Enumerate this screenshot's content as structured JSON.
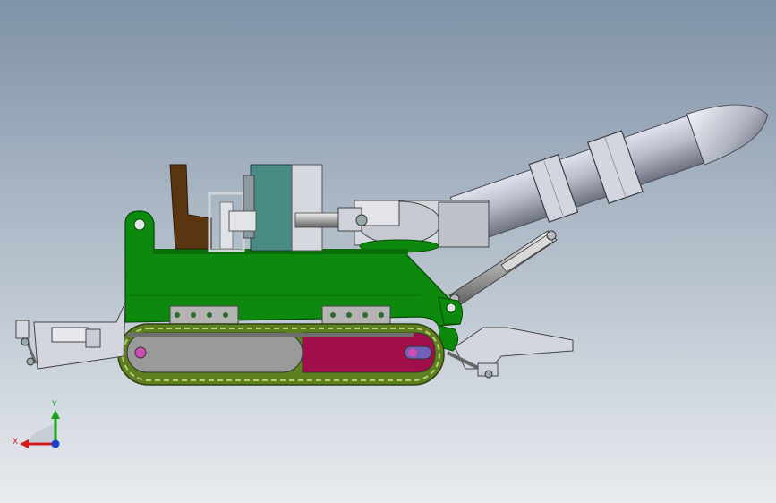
{
  "colors": {
    "bg_top": "#7f92a7",
    "bg_bottom": "#e8ebef",
    "body_green": "#0d8a0d",
    "body_green_dark": "#0a6e0a",
    "track_gray": "#9a9a9a",
    "track_magenta": "#a00f4a",
    "track_chain": "#6b8f2a",
    "brown": "#5a3512",
    "teal": "#4a8a85",
    "metal": "#c9ccd6",
    "metal_dark": "#7c7f88",
    "axis_x": "#d11b1b",
    "axis_y": "#19a319",
    "axis_z": "#1b3fd1"
  },
  "triad": {
    "x_label": "X",
    "y_label": "Y"
  }
}
